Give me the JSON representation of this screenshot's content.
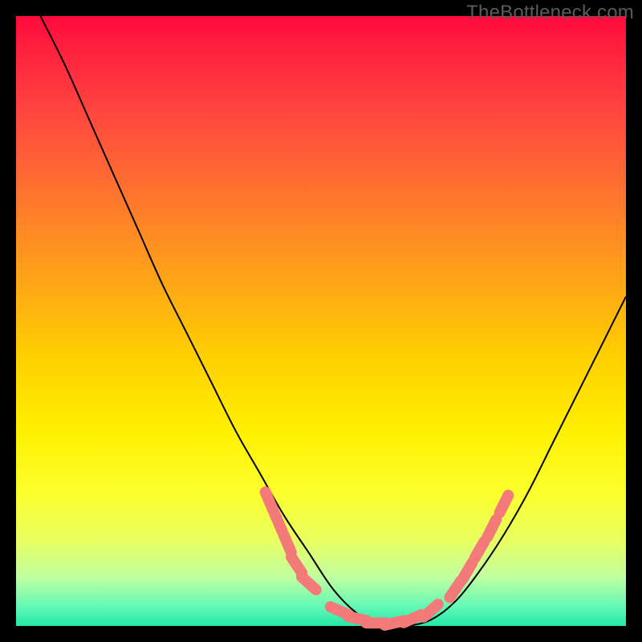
{
  "attribution": "TheBottleneck.com",
  "colors": {
    "curve": "#000000",
    "marker": "#f47a7a",
    "background_top": "#ff0a3c",
    "background_bottom": "#22e8a8"
  },
  "chart_data": {
    "type": "line",
    "title": "",
    "xlabel": "",
    "ylabel": "",
    "xlim": [
      0,
      100
    ],
    "ylim": [
      0,
      100
    ],
    "grid": false,
    "series": [
      {
        "name": "bottleneck-curve",
        "x": [
          4,
          8,
          12,
          16,
          20,
          24,
          28,
          32,
          36,
          40,
          44,
          48,
          52,
          56,
          60,
          64,
          68,
          72,
          76,
          80,
          84,
          88,
          92,
          96,
          100
        ],
        "y": [
          100,
          92,
          83,
          74,
          65,
          56,
          48,
          40,
          32,
          25,
          18,
          12,
          6,
          2,
          0,
          0,
          1,
          4,
          9,
          15,
          22,
          30,
          38,
          46,
          54
        ]
      }
    ],
    "markers": [
      {
        "x": 41.5,
        "y": 20.5
      },
      {
        "x": 43.0,
        "y": 17.0
      },
      {
        "x": 44.5,
        "y": 13.5
      },
      {
        "x": 46.0,
        "y": 10.0
      },
      {
        "x": 48.0,
        "y": 7.0
      },
      {
        "x": 53.0,
        "y": 2.5
      },
      {
        "x": 56.0,
        "y": 1.2
      },
      {
        "x": 59.0,
        "y": 0.5
      },
      {
        "x": 62.0,
        "y": 0.5
      },
      {
        "x": 65.0,
        "y": 1.2
      },
      {
        "x": 68.0,
        "y": 2.5
      },
      {
        "x": 72.0,
        "y": 6.0
      },
      {
        "x": 74.0,
        "y": 9.0
      },
      {
        "x": 76.0,
        "y": 12.5
      },
      {
        "x": 78.0,
        "y": 16.0
      },
      {
        "x": 80.0,
        "y": 20.0
      }
    ]
  }
}
